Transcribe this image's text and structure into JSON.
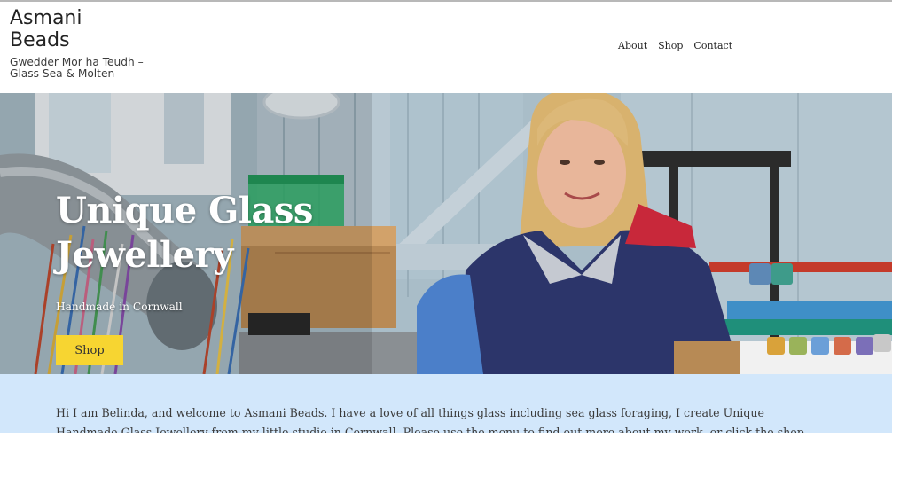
{
  "site": {
    "title": "Asmani Beads",
    "tagline": "Gwedder Mor ha Teudh – Glass Sea & Molten"
  },
  "nav": {
    "items": [
      {
        "label": "About"
      },
      {
        "label": "Shop"
      },
      {
        "label": "Contact"
      }
    ]
  },
  "hero": {
    "title": "Unique Glass Jewellery",
    "subtitle": "Handmade in Cornwall",
    "button_label": "Shop",
    "button_color": "#f7d531"
  },
  "intro": {
    "text": "Hi I am Belinda, and welcome to Asmani Beads. I have a love of all things glass including sea glass foraging, I create Unique Handmade Glass Jewellery from my little studio in Cornwall. Please use the menu to find out more about my work, or click the shop button where you can see",
    "background": "#d2e7fb"
  }
}
